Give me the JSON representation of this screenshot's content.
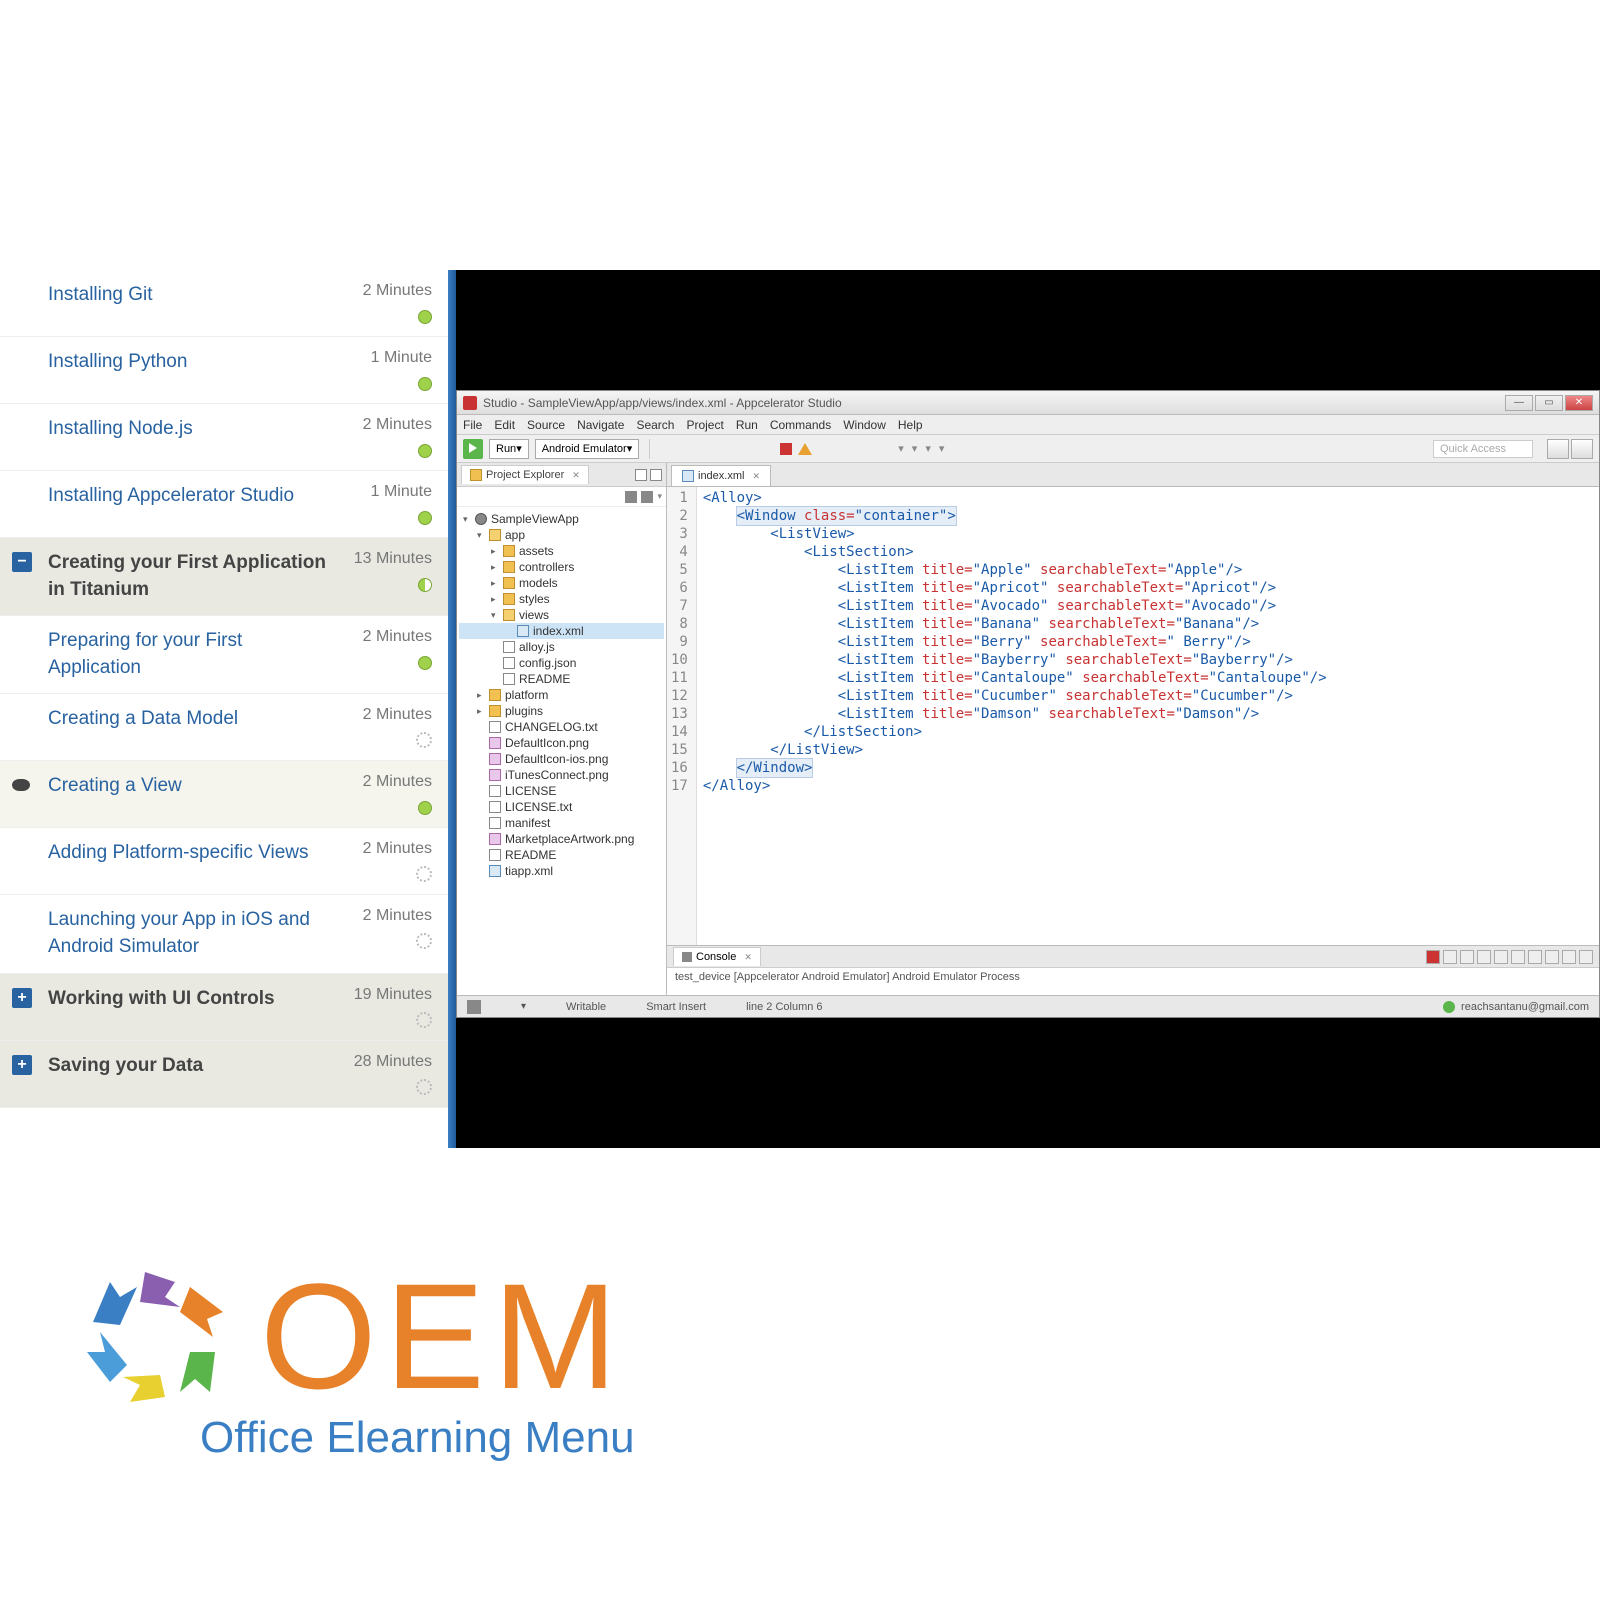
{
  "course_nav": {
    "items": [
      {
        "title": "Installing Git",
        "duration": "2 Minutes",
        "status": "green",
        "indent": false
      },
      {
        "title": "Installing Python",
        "duration": "1 Minute",
        "status": "green",
        "indent": false
      },
      {
        "title": "Installing Node.js",
        "duration": "2 Minutes",
        "status": "green",
        "indent": false
      },
      {
        "title": "Installing Appcelerator Studio",
        "duration": "1 Minute",
        "status": "green",
        "indent": false
      },
      {
        "title": "Creating your First Application in Titanium",
        "duration": "13 Minutes",
        "status": "half",
        "icon": "minus",
        "section": true
      },
      {
        "title": "Preparing for your First Application",
        "duration": "2 Minutes",
        "status": "green",
        "indent": false
      },
      {
        "title": "Creating a Data Model",
        "duration": "2 Minutes",
        "status": "loading",
        "indent": false
      },
      {
        "title": "Creating a View",
        "duration": "2 Minutes",
        "status": "green",
        "icon": "eye",
        "current": true
      },
      {
        "title": "Adding Platform-specific Views",
        "duration": "2 Minutes",
        "status": "loading",
        "indent": false
      },
      {
        "title": "Launching your App in iOS and Android Simulator",
        "duration": "2 Minutes",
        "status": "loading",
        "indent": false
      },
      {
        "title": "Working with UI Controls",
        "duration": "19 Minutes",
        "status": "loading",
        "icon": "plus",
        "section": true
      },
      {
        "title": "Saving your Data",
        "duration": "28 Minutes",
        "status": "loading",
        "icon": "plus",
        "section": true
      }
    ]
  },
  "ide": {
    "title": "Studio - SampleViewApp/app/views/index.xml - Appcelerator Studio",
    "menu": [
      "File",
      "Edit",
      "Source",
      "Navigate",
      "Search",
      "Project",
      "Run",
      "Commands",
      "Window",
      "Help"
    ],
    "run_label": "Run",
    "run_target": "Android Emulator",
    "quick_access": "Quick Access",
    "explorer": {
      "tab": "Project Explorer",
      "tree": [
        {
          "label": "SampleViewApp",
          "depth": 0,
          "icon": "node",
          "expanded": true
        },
        {
          "label": "app",
          "depth": 1,
          "icon": "folder-open",
          "expanded": true
        },
        {
          "label": "assets",
          "depth": 2,
          "icon": "folder"
        },
        {
          "label": "controllers",
          "depth": 2,
          "icon": "folder"
        },
        {
          "label": "models",
          "depth": 2,
          "icon": "folder"
        },
        {
          "label": "styles",
          "depth": 2,
          "icon": "folder"
        },
        {
          "label": "views",
          "depth": 2,
          "icon": "folder-open",
          "expanded": true
        },
        {
          "label": "index.xml",
          "depth": 3,
          "icon": "xml",
          "selected": true
        },
        {
          "label": "alloy.js",
          "depth": 2,
          "icon": "file"
        },
        {
          "label": "config.json",
          "depth": 2,
          "icon": "file"
        },
        {
          "label": "README",
          "depth": 2,
          "icon": "file"
        },
        {
          "label": "platform",
          "depth": 1,
          "icon": "folder"
        },
        {
          "label": "plugins",
          "depth": 1,
          "icon": "folder"
        },
        {
          "label": "CHANGELOG.txt",
          "depth": 1,
          "icon": "file"
        },
        {
          "label": "DefaultIcon.png",
          "depth": 1,
          "icon": "img"
        },
        {
          "label": "DefaultIcon-ios.png",
          "depth": 1,
          "icon": "img"
        },
        {
          "label": "iTunesConnect.png",
          "depth": 1,
          "icon": "img"
        },
        {
          "label": "LICENSE",
          "depth": 1,
          "icon": "file"
        },
        {
          "label": "LICENSE.txt",
          "depth": 1,
          "icon": "file"
        },
        {
          "label": "manifest",
          "depth": 1,
          "icon": "file"
        },
        {
          "label": "MarketplaceArtwork.png",
          "depth": 1,
          "icon": "img"
        },
        {
          "label": "README",
          "depth": 1,
          "icon": "file"
        },
        {
          "label": "tiapp.xml",
          "depth": 1,
          "icon": "xml"
        }
      ]
    },
    "editor": {
      "tab": "index.xml",
      "lines": [
        {
          "n": 1,
          "html": "<span class='tag'>&lt;Alloy&gt;</span>"
        },
        {
          "n": 2,
          "html": "    <span class='line-hl'><span class='tag'>&lt;Window</span> <span class='attr'>class=</span><span class='str'>\"container\"</span><span class='tag'>&gt;</span></span>"
        },
        {
          "n": 3,
          "html": "        <span class='tag'>&lt;ListView&gt;</span>"
        },
        {
          "n": 4,
          "html": "            <span class='tag'>&lt;ListSection&gt;</span>"
        },
        {
          "n": 5,
          "html": "                <span class='tag'>&lt;ListItem</span> <span class='attr'>title=</span><span class='str'>\"Apple\"</span> <span class='attr'>searchableText=</span><span class='str'>\"Apple\"</span><span class='tag'>/&gt;</span>"
        },
        {
          "n": 6,
          "html": "                <span class='tag'>&lt;ListItem</span> <span class='attr'>title=</span><span class='str'>\"Apricot\"</span> <span class='attr'>searchableText=</span><span class='str'>\"Apricot\"</span><span class='tag'>/&gt;</span>"
        },
        {
          "n": 7,
          "html": "                <span class='tag'>&lt;ListItem</span> <span class='attr'>title=</span><span class='str'>\"Avocado\"</span> <span class='attr'>searchableText=</span><span class='str'>\"Avocado\"</span><span class='tag'>/&gt;</span>"
        },
        {
          "n": 8,
          "html": "                <span class='tag'>&lt;ListItem</span> <span class='attr'>title=</span><span class='str'>\"Banana\"</span> <span class='attr'>searchableText=</span><span class='str'>\"Banana\"</span><span class='tag'>/&gt;</span>"
        },
        {
          "n": 9,
          "html": "                <span class='tag'>&lt;ListItem</span> <span class='attr'>title=</span><span class='str'>\"Berry\"</span> <span class='attr'>searchableText=</span><span class='str'>\" Berry\"</span><span class='tag'>/&gt;</span>"
        },
        {
          "n": 10,
          "html": "                <span class='tag'>&lt;ListItem</span> <span class='attr'>title=</span><span class='str'>\"Bayberry\"</span> <span class='attr'>searchableText=</span><span class='str'>\"Bayberry\"</span><span class='tag'>/&gt;</span>"
        },
        {
          "n": 11,
          "html": "                <span class='tag'>&lt;ListItem</span> <span class='attr'>title=</span><span class='str'>\"Cantaloupe\"</span> <span class='attr'>searchableText=</span><span class='str'>\"Cantaloupe\"</span><span class='tag'>/&gt;</span>"
        },
        {
          "n": 12,
          "html": "                <span class='tag'>&lt;ListItem</span> <span class='attr'>title=</span><span class='str'>\"Cucumber\"</span> <span class='attr'>searchableText=</span><span class='str'>\"Cucumber\"</span><span class='tag'>/&gt;</span>"
        },
        {
          "n": 13,
          "html": "                <span class='tag'>&lt;ListItem</span> <span class='attr'>title=</span><span class='str'>\"Damson\"</span> <span class='attr'>searchableText=</span><span class='str'>\"Damson\"</span><span class='tag'>/&gt;</span>"
        },
        {
          "n": 14,
          "html": "            <span class='tag'>&lt;/ListSection&gt;</span>"
        },
        {
          "n": 15,
          "html": "        <span class='tag'>&lt;/ListView&gt;</span>"
        },
        {
          "n": 16,
          "html": "    <span class='line-hl'><span class='tag'>&lt;/Window&gt;</span></span>"
        },
        {
          "n": 17,
          "html": "<span class='tag'>&lt;/Alloy&gt;</span>"
        }
      ]
    },
    "console": {
      "tab": "Console",
      "text": "test_device [Appcelerator Android Emulator] Android Emulator Process"
    },
    "statusbar": {
      "writable": "Writable",
      "insert": "Smart Insert",
      "position": "line 2 Column 6",
      "user": "reachsantanu@gmail.com"
    }
  },
  "logo": {
    "oem": "OEM",
    "subtitle": "Office Elearning Menu"
  }
}
